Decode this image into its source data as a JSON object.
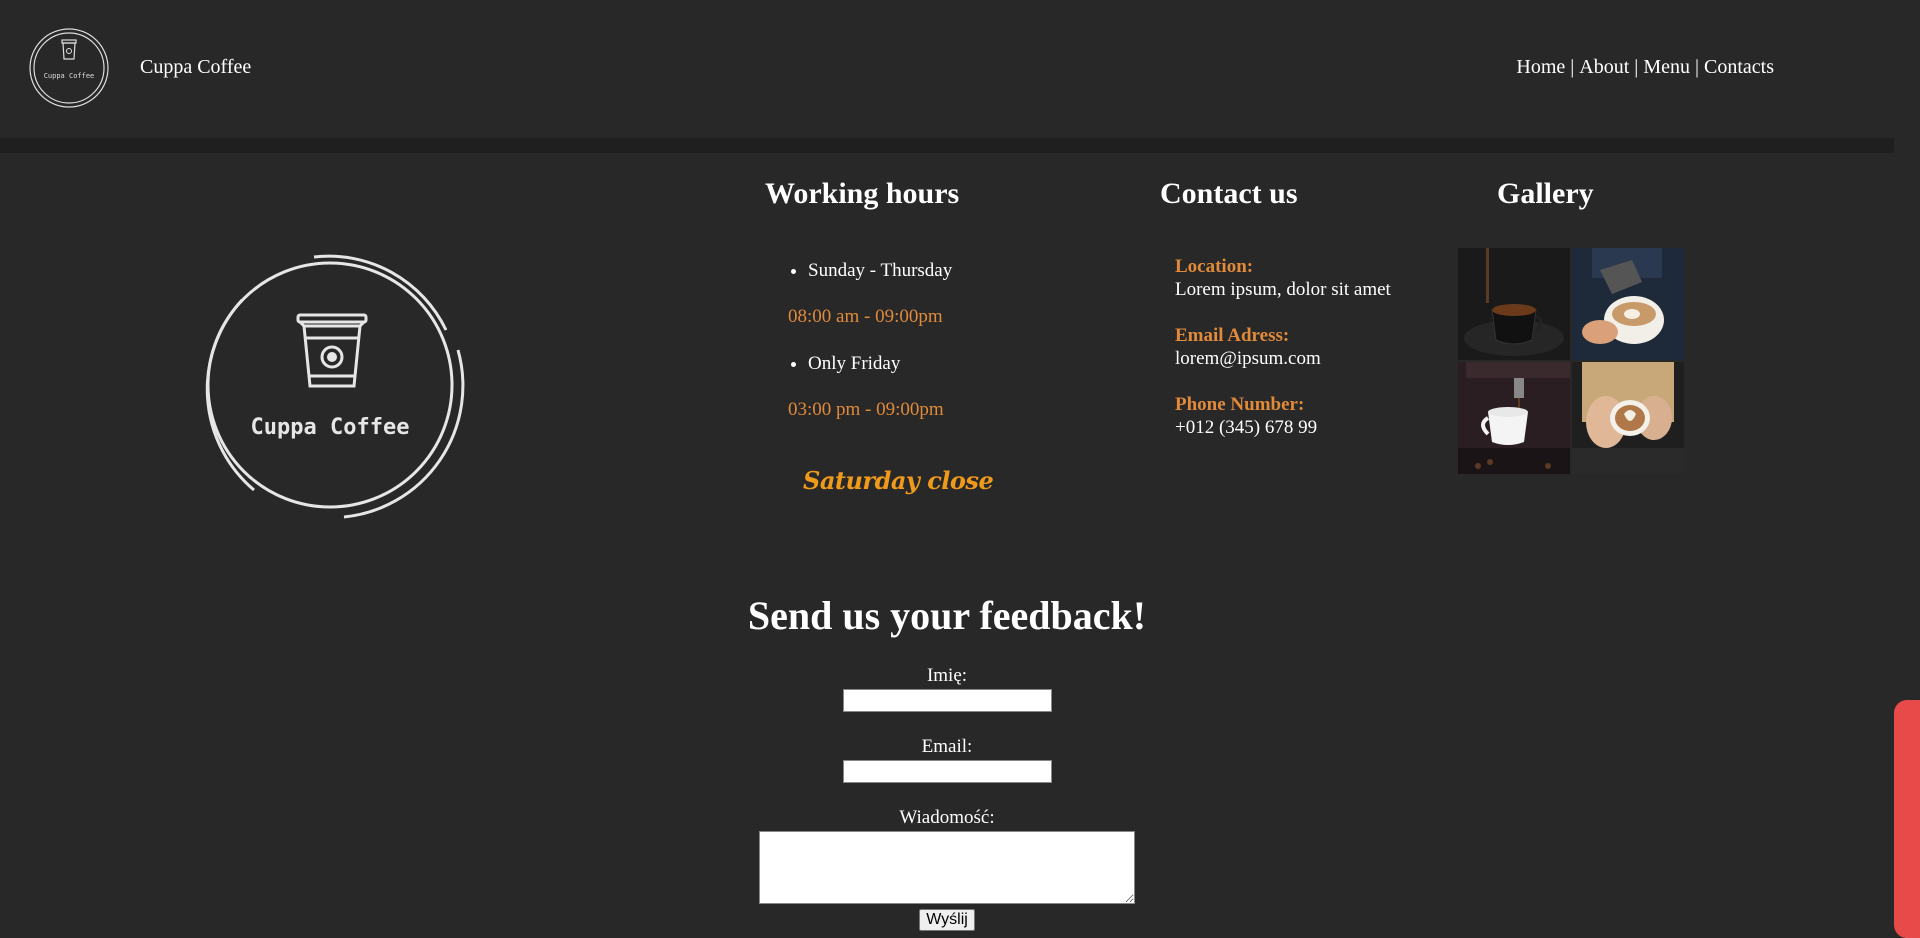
{
  "header": {
    "brand": "Cuppa Coffee",
    "logo_text": "Cuppa Coffee",
    "nav": [
      "Home",
      "About",
      "Menu",
      "Contacts"
    ],
    "separator": "|"
  },
  "hero_logo": {
    "text": "Cuppa Coffee"
  },
  "working_hours": {
    "title": "Working hours",
    "items": [
      {
        "days": "Sunday - Thursday",
        "time": "08:00 am - 09:00pm"
      },
      {
        "days": "Only Friday",
        "time": "03:00 pm - 09:00pm"
      }
    ],
    "closed": "Saturday close"
  },
  "contact": {
    "title": "Contact us",
    "location_label": "Location:",
    "location": "Lorem ipsum, dolor sit amet",
    "email_label": "Email Adress:",
    "email": "lorem@ipsum.com",
    "phone_label": "Phone Number:",
    "phone": "+012 (345) 678 99"
  },
  "gallery": {
    "title": "Gallery",
    "images": [
      "coffee-pour-cup",
      "latte-art-pour",
      "espresso-machine-cup",
      "latte-art-hands"
    ]
  },
  "feedback": {
    "title": "Send us your feedback!",
    "name_label": "Imię:",
    "email_label": "Email:",
    "message_label": "Wiadomość:",
    "submit": "Wyślij"
  },
  "colors": {
    "background": "#282828",
    "accent": "#e08a3a",
    "closed": "#f09a1c",
    "scrollbar": "#e84a4a"
  }
}
